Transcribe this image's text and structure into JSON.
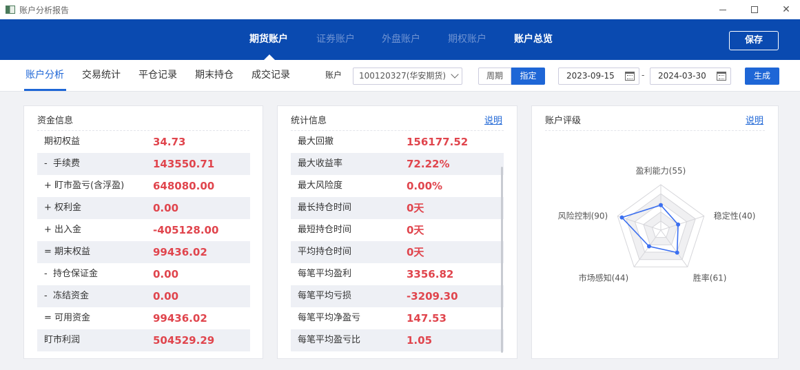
{
  "window": {
    "title": "账户分析报告"
  },
  "main_nav": {
    "tabs": [
      "期货账户",
      "证券账户",
      "外盘账户",
      "期权账户",
      "账户总览"
    ],
    "save_label": "保存"
  },
  "sub_nav": {
    "tabs": [
      "账户分析",
      "交易统计",
      "平仓记录",
      "期末持仓",
      "成交记录"
    ],
    "account_label": "账户",
    "account_value": "100120327(华安期货)",
    "period_label": "周期",
    "specify_label": "指定",
    "date_start": "2023-09-15",
    "date_sep": "-",
    "date_end": "2024-03-30",
    "generate_label": "生成"
  },
  "funds": {
    "title": "资金信息",
    "rows": [
      {
        "label": "期初权益",
        "value": "34.73"
      },
      {
        "label": "-  手续费",
        "value": "143550.71"
      },
      {
        "label": "+ 盯市盈亏(含浮盈)",
        "value": "648080.00"
      },
      {
        "label": "+ 权利金",
        "value": "0.00"
      },
      {
        "label": "+ 出入金",
        "value": "-405128.00"
      },
      {
        "label": "= 期末权益",
        "value": "99436.02"
      },
      {
        "label": "-  持仓保证金",
        "value": "0.00"
      },
      {
        "label": "-  冻结资金",
        "value": "0.00"
      },
      {
        "label": "= 可用资金",
        "value": "99436.02"
      },
      {
        "label": "盯市利润",
        "value": "504529.29"
      }
    ]
  },
  "stats": {
    "title": "统计信息",
    "link": "说明",
    "rows": [
      {
        "label": "最大回撤",
        "value": "156177.52"
      },
      {
        "label": "最大收益率",
        "value": "72.22%"
      },
      {
        "label": "最大风险度",
        "value": "0.00%"
      },
      {
        "label": "最长持仓时间",
        "value": "0天"
      },
      {
        "label": "最短持仓时间",
        "value": "0天"
      },
      {
        "label": "平均持仓时间",
        "value": "0天"
      },
      {
        "label": "每笔平均盈利",
        "value": "3356.82"
      },
      {
        "label": "每笔平均亏损",
        "value": "-3209.30"
      },
      {
        "label": "每笔平均净盈亏",
        "value": "147.53"
      },
      {
        "label": "每笔平均盈亏比",
        "value": "1.05"
      }
    ]
  },
  "rating": {
    "title": "账户评级",
    "link": "说明",
    "max": 100,
    "axes": [
      {
        "label": "盈利能力(55)",
        "value": 55
      },
      {
        "label": "稳定性(40)",
        "value": 40
      },
      {
        "label": "胜率(61)",
        "value": 61
      },
      {
        "label": "市场感知(44)",
        "value": 44
      },
      {
        "label": "风险控制(90)",
        "value": 90
      }
    ]
  },
  "colors": {
    "nav_bg": "#0a4ab0",
    "accent": "#1e66d6",
    "value_red": "#e0454d",
    "radar_line": "#3b6ff0"
  }
}
